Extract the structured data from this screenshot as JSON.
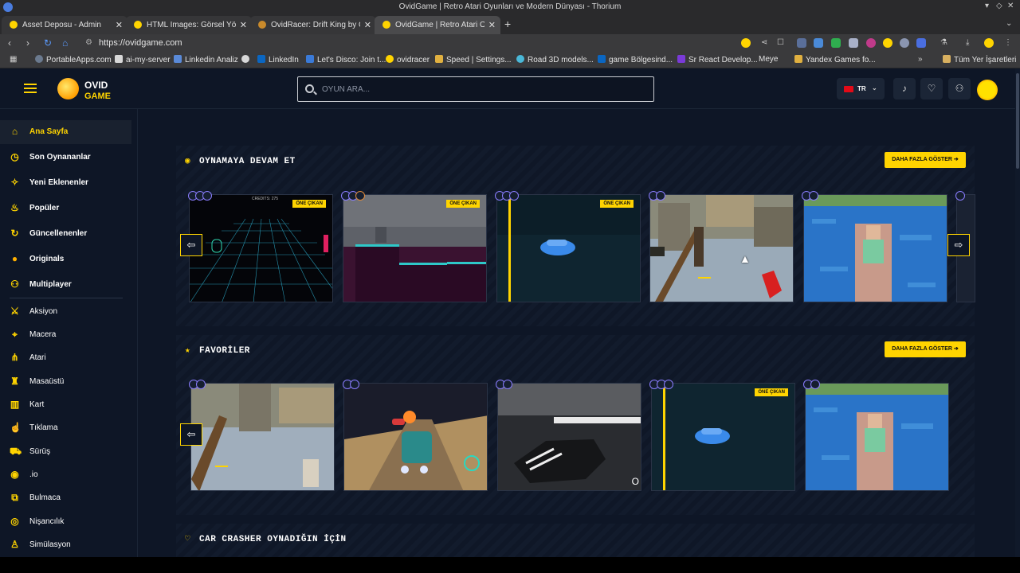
{
  "browser": {
    "window_title": "OvidGame | Retro Atari Oyunları ve Modern Dünyası - Thorium",
    "tabs": [
      {
        "label": "Asset Deposu - Admin"
      },
      {
        "label": "HTML Images: Görsel Yöne"
      },
      {
        "label": "OvidRacer: Drift King by Ov"
      },
      {
        "label": "OvidGame | Retro Atari Oy"
      }
    ],
    "url": "https://ovidgame.com",
    "bookmarks": [
      "PortableApps.com",
      "ai-my-server",
      "Linkedin Analiz",
      "LinkedIn",
      "Let's Disco: Join t...",
      "ovidracer",
      "Speed | Settings...",
      "Road 3D models...",
      "game Bölgesind...",
      "Sr React Develop...",
      "Meye",
      "Yandex Games fo...",
      "Tüm Yer İşaretleri"
    ]
  },
  "header": {
    "logo_line1": "OVID",
    "logo_line2": "GAME",
    "search_placeholder": "OYUN ARA...",
    "lang": "TR"
  },
  "sidebar": {
    "items": [
      {
        "label": "Ana Sayfa",
        "icon": "home-icon",
        "glyph": "⌂"
      },
      {
        "label": "Son Oynananlar",
        "icon": "clock-icon",
        "glyph": "◷"
      },
      {
        "label": "Yeni Eklenenler",
        "icon": "sparkle-icon",
        "glyph": "✧"
      },
      {
        "label": "Popüler",
        "icon": "flame-icon",
        "glyph": "♨"
      },
      {
        "label": "Güncellenenler",
        "icon": "refresh-icon",
        "glyph": "↻"
      },
      {
        "label": "Originals",
        "icon": "ovid-logo-icon",
        "glyph": "●"
      },
      {
        "label": "Multiplayer",
        "icon": "users-icon",
        "glyph": "⚇"
      },
      {
        "label": "Aksiyon",
        "icon": "sword-icon",
        "glyph": "⚔"
      },
      {
        "label": "Macera",
        "icon": "compass-icon",
        "glyph": "⌖"
      },
      {
        "label": "Atari",
        "icon": "atari-icon",
        "glyph": "⋔"
      },
      {
        "label": "Masaüstü",
        "icon": "chess-icon",
        "glyph": "♜"
      },
      {
        "label": "Kart",
        "icon": "cards-icon",
        "glyph": "▥"
      },
      {
        "label": "Tıklama",
        "icon": "pointer-icon",
        "glyph": "☝"
      },
      {
        "label": "Sürüş",
        "icon": "car-icon",
        "glyph": "⛟"
      },
      {
        "label": ".io",
        "icon": "dot-io-icon",
        "glyph": "◉"
      },
      {
        "label": "Bulmaca",
        "icon": "puzzle-icon",
        "glyph": "⧉"
      },
      {
        "label": "Nişancılık",
        "icon": "target-icon",
        "glyph": "◎"
      },
      {
        "label": "Simülasyon",
        "icon": "person-icon",
        "glyph": "♙"
      }
    ]
  },
  "sections": [
    {
      "title": "OYNAMAYA DEVAM ET",
      "icon": "play-circle-icon",
      "more_label": "DAHA FAZLA GÖSTER ➔"
    },
    {
      "title": "FAVORİLER",
      "icon": "star-icon",
      "more_label": "DAHA FAZLA GÖSTER ➔"
    },
    {
      "title": "CAR CRASHER OYNADIĞIN İÇİN",
      "icon": "heart-icon",
      "more_label": ""
    }
  ],
  "badge_label": "ÖNE ÇIKAN",
  "card_credit_text": "CREDITS: 275",
  "card_stray_text": "O",
  "colors": {
    "accent": "#ffd400",
    "bg": "#0e1626",
    "panel": "#19212f"
  }
}
